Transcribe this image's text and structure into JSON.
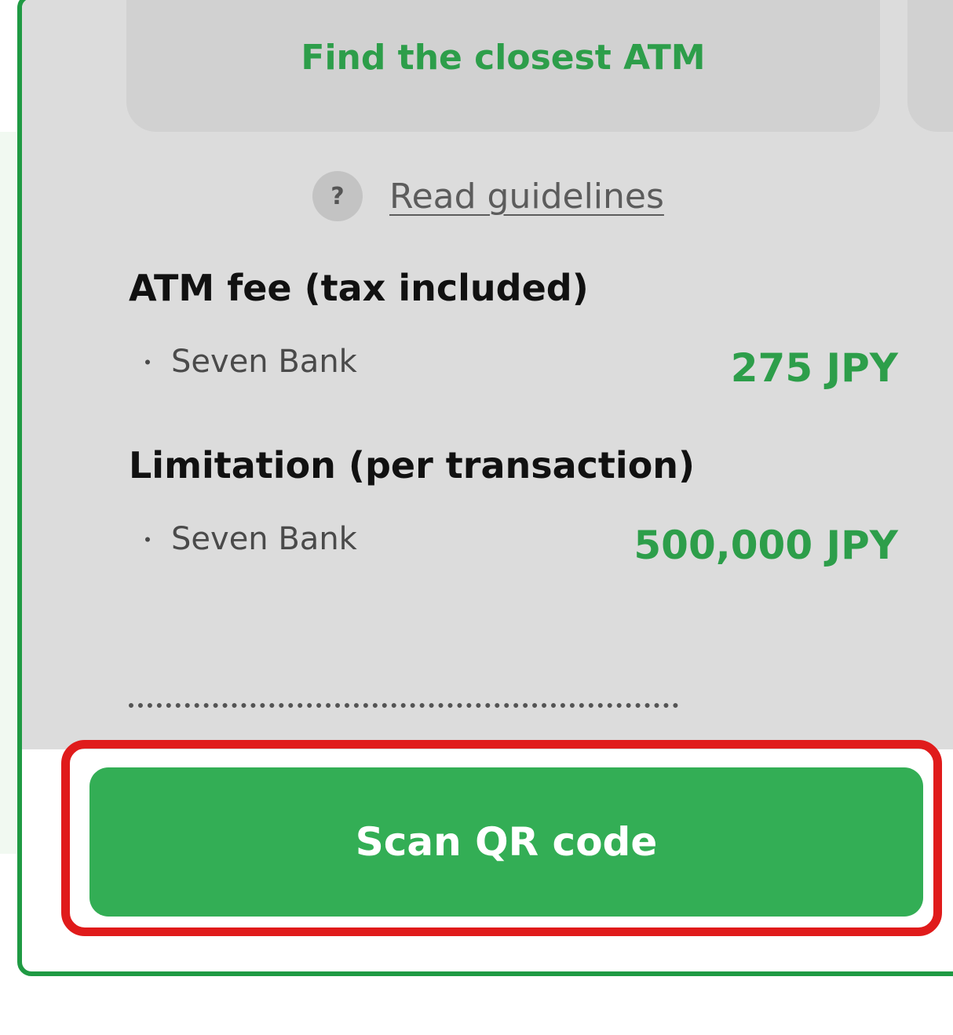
{
  "atm_card": {
    "label": "Find the closest ATM"
  },
  "guidelines": {
    "icon": "?",
    "link_label": "Read guidelines"
  },
  "fee_section": {
    "heading": "ATM fee (tax included)",
    "rows": [
      {
        "bullet": "・",
        "bank": "Seven Bank",
        "value": "275 JPY"
      }
    ]
  },
  "limit_section": {
    "heading": "Limitation (per transaction)",
    "rows": [
      {
        "bullet": "・",
        "bank": "Seven Bank",
        "value": "500,000 JPY"
      }
    ]
  },
  "primary_action": {
    "label": "Scan QR code"
  },
  "colors": {
    "accent": "#2d9e4a",
    "button": "#33ae55",
    "highlight": "#e01b1b",
    "frame": "#1f9a43"
  }
}
